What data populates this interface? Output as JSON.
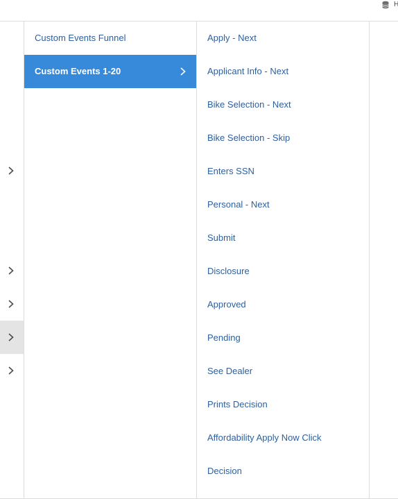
{
  "topbar": {
    "icon": "database-icon",
    "edge_text": "H"
  },
  "left_column": {
    "chevron_icon": "chevron-right-icon",
    "rows": [
      {
        "has_chevron": true,
        "active": false
      },
      {
        "has_chevron": true,
        "active": false
      },
      {
        "has_chevron": true,
        "active": false
      },
      {
        "has_chevron": true,
        "active": true
      },
      {
        "has_chevron": true,
        "active": false
      }
    ]
  },
  "middle_column": {
    "items": [
      {
        "label": "Custom Events Funnel",
        "selected": false
      },
      {
        "label": "Custom Events 1-20",
        "selected": true
      }
    ]
  },
  "right_column": {
    "items": [
      {
        "label": "Apply - Next"
      },
      {
        "label": "Applicant Info - Next"
      },
      {
        "label": "Bike Selection - Next"
      },
      {
        "label": "Bike Selection - Skip"
      },
      {
        "label": "Enters SSN"
      },
      {
        "label": "Personal - Next"
      },
      {
        "label": "Submit"
      },
      {
        "label": "Disclosure"
      },
      {
        "label": "Approved"
      },
      {
        "label": "Pending"
      },
      {
        "label": "See Dealer"
      },
      {
        "label": "Prints Decision"
      },
      {
        "label": "Affordability Apply Now Click"
      },
      {
        "label": "Decision"
      }
    ]
  },
  "colors": {
    "link": "#2c5f9e",
    "selected_bg": "#378ad9",
    "active_row_bg": "#e4e4e4",
    "border": "#dcdcdc"
  }
}
